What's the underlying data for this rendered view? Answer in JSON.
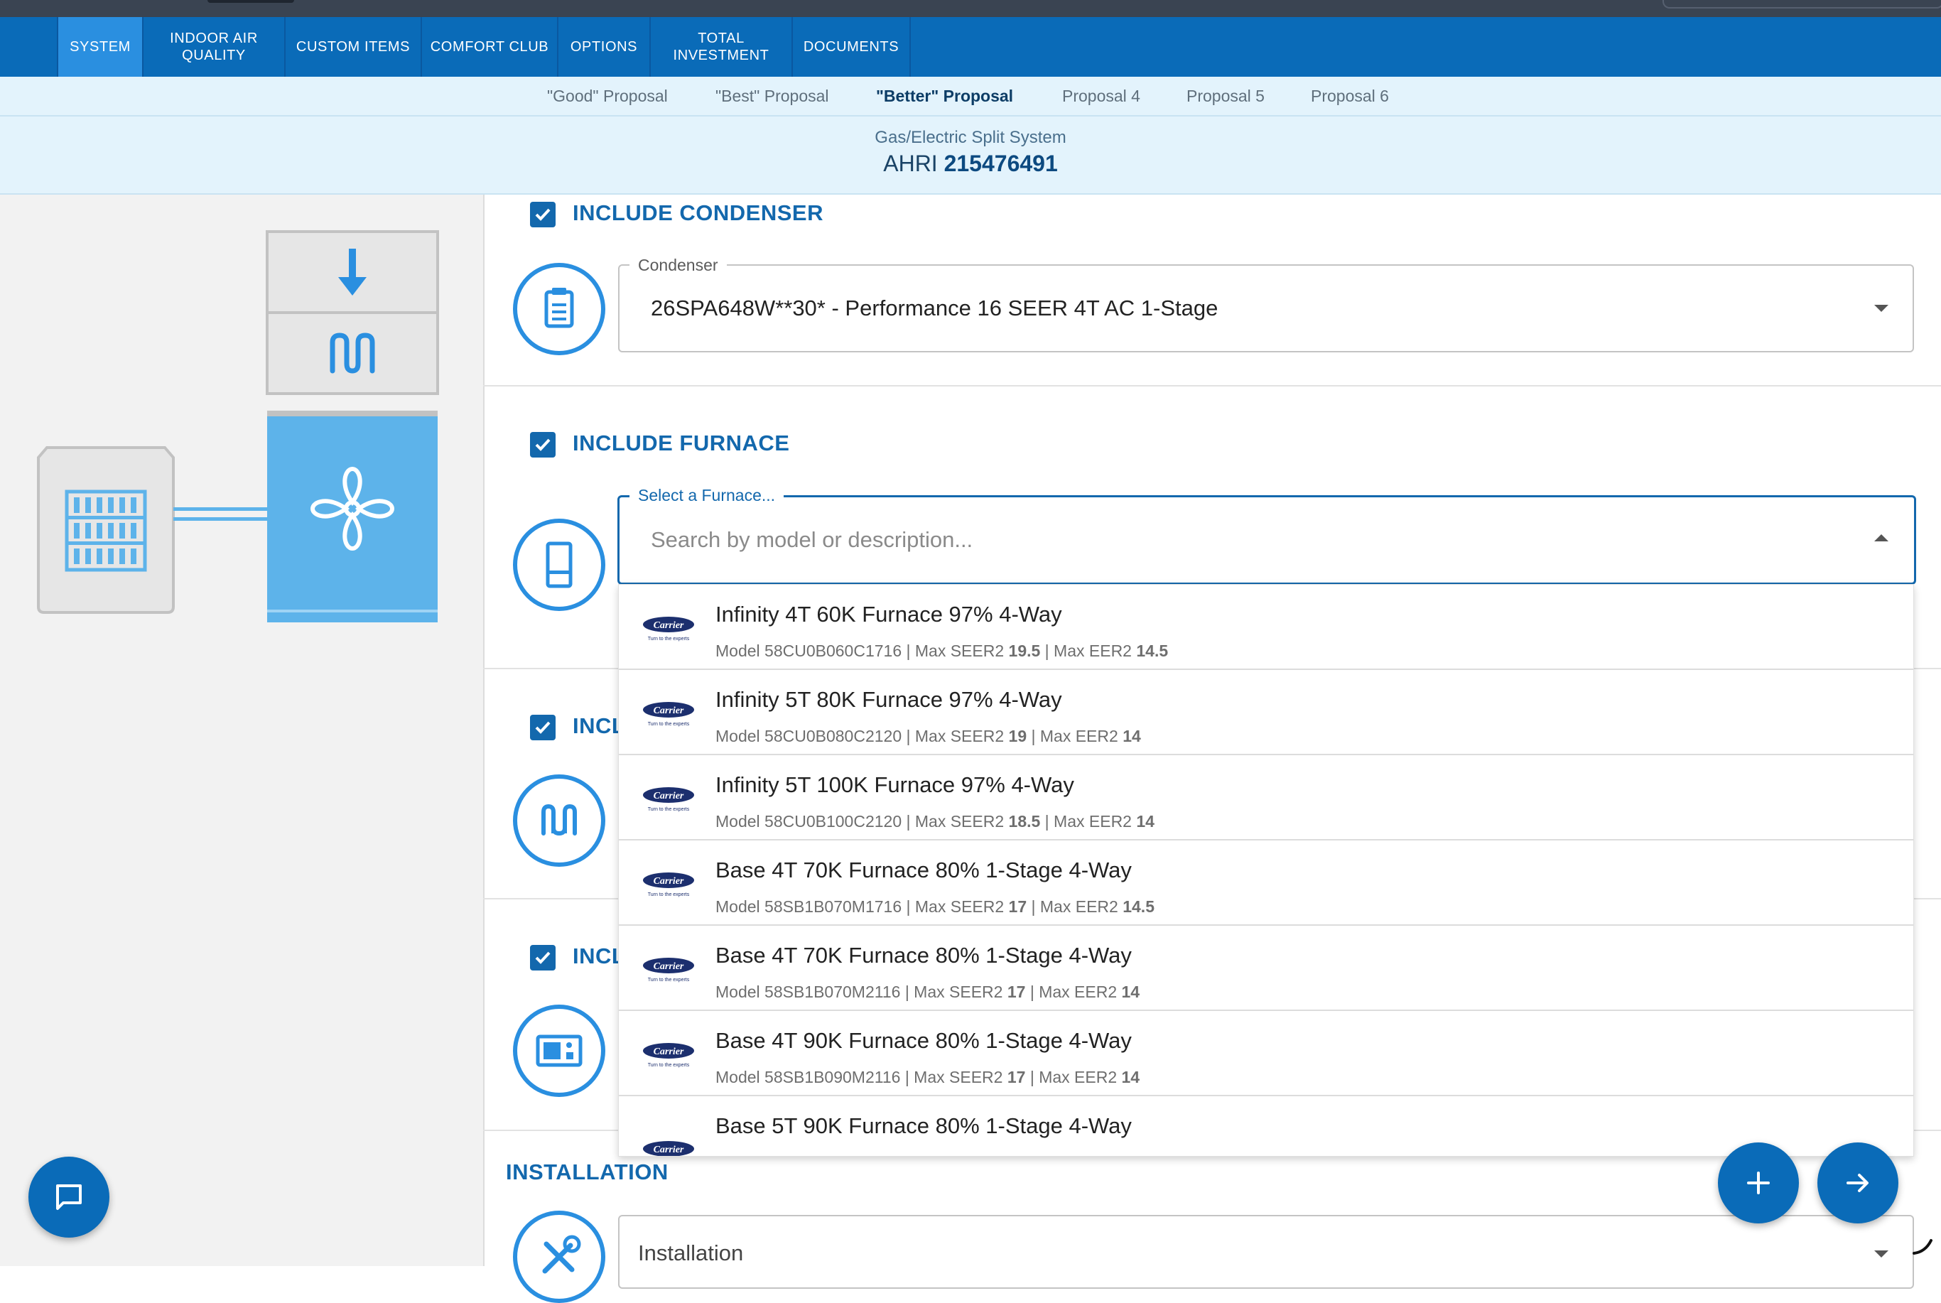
{
  "nav": {
    "items": [
      {
        "label": "SYSTEM",
        "active": true
      },
      {
        "label": "INDOOR AIR\nQUALITY",
        "active": false
      },
      {
        "label": "CUSTOM ITEMS",
        "active": false
      },
      {
        "label": "COMFORT CLUB",
        "active": false
      },
      {
        "label": "OPTIONS",
        "active": false
      },
      {
        "label": "TOTAL\nINVESTMENT",
        "active": false
      },
      {
        "label": "DOCUMENTS",
        "active": false
      }
    ]
  },
  "proposals": {
    "tabs": [
      {
        "label": "\"Good\" Proposal",
        "active": false
      },
      {
        "label": "\"Best\" Proposal",
        "active": false
      },
      {
        "label": "\"Better\" Proposal",
        "active": true
      },
      {
        "label": "Proposal 4",
        "active": false
      },
      {
        "label": "Proposal 5",
        "active": false
      },
      {
        "label": "Proposal 6",
        "active": false
      }
    ]
  },
  "system": {
    "subtitle": "Gas/Electric Split System",
    "ahri_prefix": "AHRI",
    "ahri_number": "215476491"
  },
  "condenser": {
    "title": "INCLUDE CONDENSER",
    "checked": true,
    "field_label": "Condenser",
    "value": "26SPA648W**30* - Performance 16 SEER 4T AC 1-Stage"
  },
  "furnace": {
    "title": "INCLUDE FURNACE",
    "checked": true,
    "field_label": "Select a Furnace...",
    "placeholder": "Search by model or description..."
  },
  "section3": {
    "title_partial": "INCL",
    "checked": true
  },
  "section4": {
    "title_partial": "INCL",
    "checked": true
  },
  "installation": {
    "title": "INSTALLATION",
    "field_label": "Installation"
  },
  "furnace_options": [
    {
      "title": "Infinity 4T 60K Furnace 97% 4-Way",
      "model_prefix": "Model 58CU0B060C1716 | Max SEER2 ",
      "seer2": "19.5",
      "eer_prefix": " | Max EER2 ",
      "eer2": "14.5"
    },
    {
      "title": "Infinity 5T 80K Furnace 97% 4-Way",
      "model_prefix": "Model 58CU0B080C2120 | Max SEER2 ",
      "seer2": "19",
      "eer_prefix": " | Max EER2 ",
      "eer2": "14"
    },
    {
      "title": "Infinity 5T 100K Furnace 97% 4-Way",
      "model_prefix": "Model 58CU0B100C2120 | Max SEER2 ",
      "seer2": "18.5",
      "eer_prefix": " | Max EER2 ",
      "eer2": "14"
    },
    {
      "title": "Base 4T 70K Furnace 80% 1-Stage 4-Way",
      "model_prefix": "Model 58SB1B070M1716 | Max SEER2 ",
      "seer2": "17",
      "eer_prefix": " | Max EER2 ",
      "eer2": "14.5"
    },
    {
      "title": "Base 4T 70K Furnace 80% 1-Stage 4-Way",
      "model_prefix": "Model 58SB1B070M2116 | Max SEER2 ",
      "seer2": "17",
      "eer_prefix": " | Max EER2 ",
      "eer2": "14"
    },
    {
      "title": "Base 4T 90K Furnace 80% 1-Stage 4-Way",
      "model_prefix": "Model 58SB1B090M2116 | Max SEER2 ",
      "seer2": "17",
      "eer_prefix": " | Max EER2 ",
      "eer2": "14"
    },
    {
      "title": "Base 5T 90K Furnace 80% 1-Stage 4-Way",
      "model_prefix": "",
      "seer2": "",
      "eer_prefix": "",
      "eer2": ""
    }
  ],
  "brand_logo_text": "Carrier",
  "brand_tagline": "Turn to the experts",
  "colors": {
    "nav_bg": "#0a6bb8",
    "nav_active": "#2a8fe0",
    "accent": "#1368ad",
    "proposal_bg": "#e3f3fc",
    "diagram_blue": "#5db3ea"
  },
  "icons": {
    "chat": "chat-icon",
    "add": "plus-icon",
    "next": "arrow-right-icon"
  }
}
